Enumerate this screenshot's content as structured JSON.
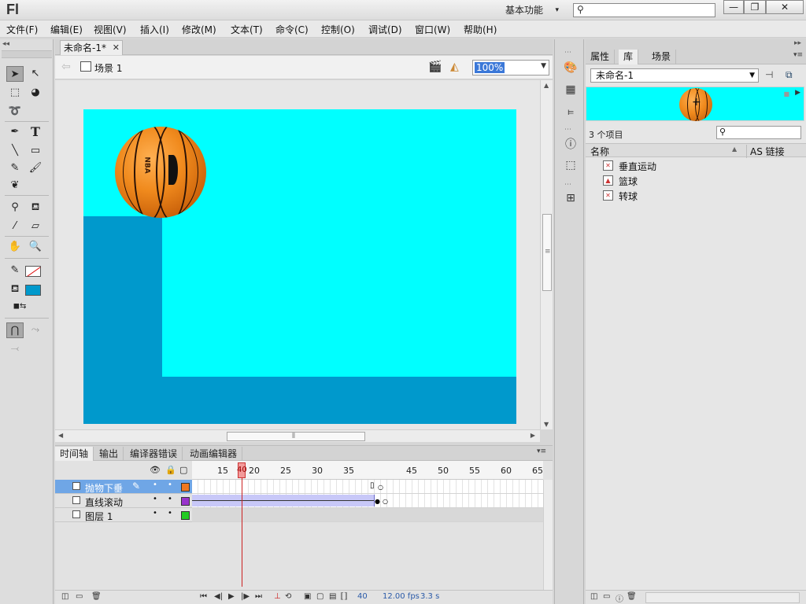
{
  "app": {
    "logo": "Fl",
    "workspace": "基本功能",
    "window_buttons": {
      "minimize": "—",
      "maximize": "❐",
      "close": "✕"
    }
  },
  "menu": [
    "文件(F)",
    "编辑(E)",
    "视图(V)",
    "插入(I)",
    "修改(M)",
    "文本(T)",
    "命令(C)",
    "控制(O)",
    "调试(D)",
    "窗口(W)",
    "帮助(H)"
  ],
  "document": {
    "tab_title": "未命名-1*",
    "scene": "场景 1",
    "zoom": "100%"
  },
  "stage": {
    "background": "#00ffff",
    "ground_color": "#0099cc",
    "ball_brand": "NBA"
  },
  "bottom_panel": {
    "tabs": [
      "时间轴",
      "输出",
      "编译器错误",
      "动画编辑器"
    ],
    "ruler": [
      "15",
      "20",
      "25",
      "30",
      "35",
      "40",
      "45",
      "50",
      "55",
      "60",
      "65"
    ],
    "current_frame_ruler": "40",
    "layers": [
      {
        "name": "抛物下垂",
        "color": "#f07820",
        "selected": true
      },
      {
        "name": "直线滚动",
        "color": "#9933cc",
        "selected": false
      },
      {
        "name": "图层 1",
        "color": "#22cc22",
        "selected": false
      }
    ],
    "status": {
      "frame": "40",
      "fps": "12.00 fps",
      "time": "3.3 s"
    }
  },
  "library": {
    "tabs": [
      "属性",
      "库",
      "场景"
    ],
    "document": "未命名-1",
    "item_count": "3 个项目",
    "columns": {
      "name": "名称",
      "linkage": "AS 链接"
    },
    "items": [
      "垂直运动",
      "篮球",
      "转球"
    ]
  },
  "icons": [
    "search-icon",
    "selection-tool-icon",
    "subselection-tool-icon",
    "free-transform-icon",
    "3d-rotation-icon",
    "lasso-icon",
    "pen-icon",
    "text-tool-icon",
    "line-tool-icon",
    "rectangle-tool-icon",
    "pencil-icon",
    "brush-icon",
    "deco-icon",
    "bone-icon",
    "paint-bucket-icon",
    "eyedropper-icon",
    "eraser-icon",
    "hand-icon",
    "zoom-icon"
  ]
}
